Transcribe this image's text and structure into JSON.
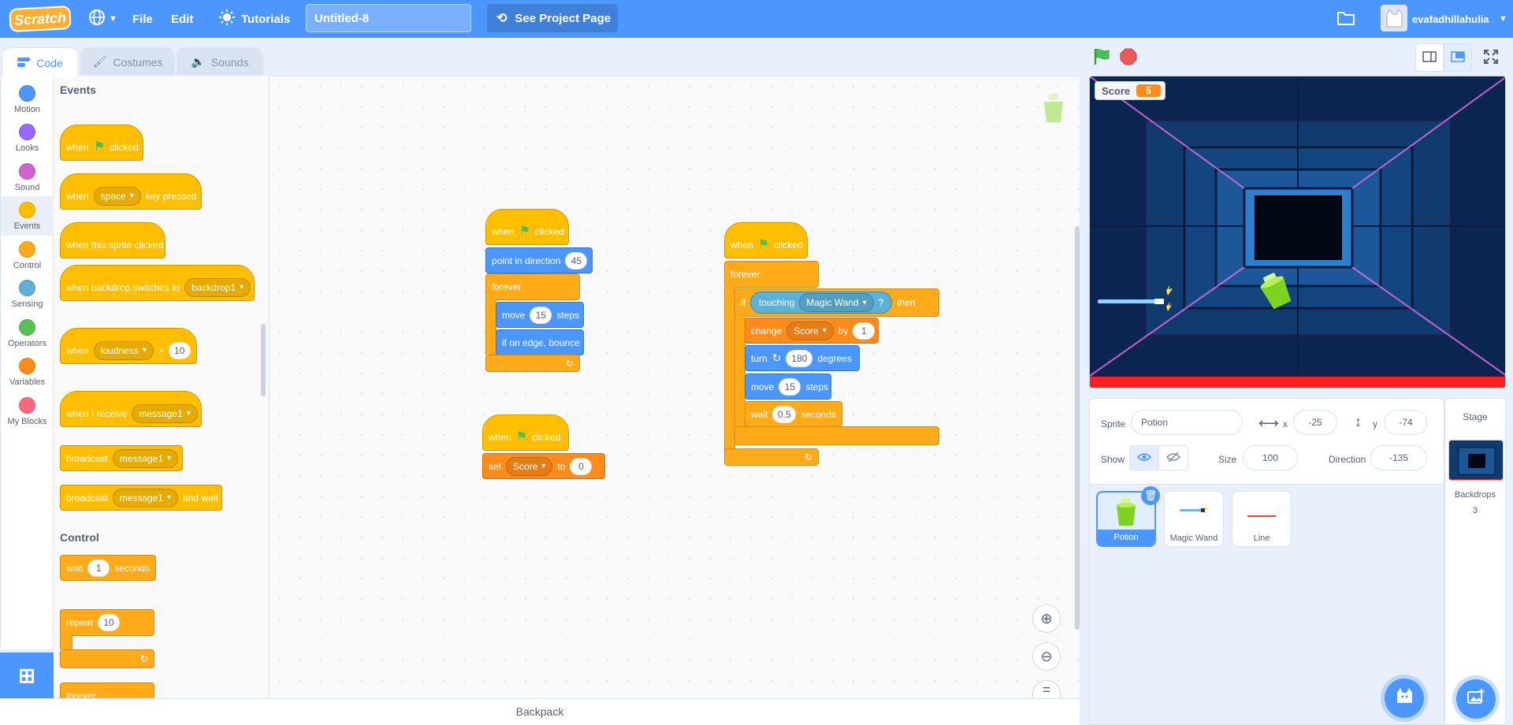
{
  "menubar": {
    "logo": "Scratch",
    "file": "File",
    "edit": "Edit",
    "tutorials": "Tutorials",
    "project_title": "Untitled-8",
    "see_project_page": "See Project Page",
    "username": "evafadhillahulia"
  },
  "tabs": [
    {
      "label": "Code"
    },
    {
      "label": "Costumes"
    },
    {
      "label": "Sounds"
    }
  ],
  "categories": [
    {
      "label": "Motion",
      "color": "#4c97ff"
    },
    {
      "label": "Looks",
      "color": "#9966ff"
    },
    {
      "label": "Sound",
      "color": "#cf63cf"
    },
    {
      "label": "Events",
      "color": "#ffbf00"
    },
    {
      "label": "Control",
      "color": "#ffab19"
    },
    {
      "label": "Sensing",
      "color": "#5cb1d6"
    },
    {
      "label": "Operators",
      "color": "#59c059"
    },
    {
      "label": "Variables",
      "color": "#ff8c1a"
    },
    {
      "label": "My Blocks",
      "color": "#ff6680"
    }
  ],
  "palette": {
    "events_title": "Events",
    "control_title": "Control",
    "when": "when",
    "clicked": "clicked",
    "space": "space",
    "key_pressed": "key pressed",
    "when_sprite_clicked": "when this sprite clicked",
    "when_backdrop_switches": "when backdrop switches to",
    "backdrop1": "backdrop1",
    "loudness": "loudness",
    "gt": ">",
    "ten": "10",
    "when_i_receive": "when I receive",
    "message1": "message1",
    "broadcast": "broadcast",
    "and_wait": "and wait",
    "wait": "wait",
    "one": "1",
    "seconds": "seconds",
    "repeat": "repeat",
    "forever": "forever"
  },
  "scripts": {
    "s1": {
      "when": "when",
      "clicked": "clicked",
      "point_in_direction": "point in direction",
      "direction": "45",
      "forever": "forever",
      "move": "move",
      "steps_val": "15",
      "steps": "steps",
      "bounce": "if on edge, bounce"
    },
    "s2": {
      "when": "when",
      "clicked": "clicked",
      "set": "set",
      "var": "Score",
      "to": "to",
      "val": "0"
    },
    "s3": {
      "when": "when",
      "clicked": "clicked",
      "forever": "forever",
      "if": "if",
      "touching": "touching",
      "target": "Magic Wand",
      "q": "?",
      "then": "then",
      "change": "change",
      "var": "Score",
      "by": "by",
      "by_val": "1",
      "turn": "turn",
      "degrees_val": "180",
      "degrees": "degrees",
      "move": "move",
      "steps_val": "15",
      "steps": "steps",
      "wait": "wait",
      "wait_val": "0.5",
      "seconds": "seconds"
    }
  },
  "backpack": "Backpack",
  "stage": {
    "monitor_label": "Score",
    "monitor_value": "5"
  },
  "sprite_info": {
    "sprite_label": "Sprite",
    "sprite_name": "Potion",
    "x_label": "x",
    "x_value": "-25",
    "y_label": "y",
    "y_value": "-74",
    "show_label": "Show",
    "size_label": "Size",
    "size_value": "100",
    "direction_label": "Direction",
    "direction_value": "-135"
  },
  "sprites": [
    {
      "name": "Potion"
    },
    {
      "name": "Magic Wand"
    },
    {
      "name": "Line"
    }
  ],
  "stage_panel": {
    "title": "Stage",
    "backdrops_label": "Backdrops",
    "backdrops_count": "3"
  }
}
